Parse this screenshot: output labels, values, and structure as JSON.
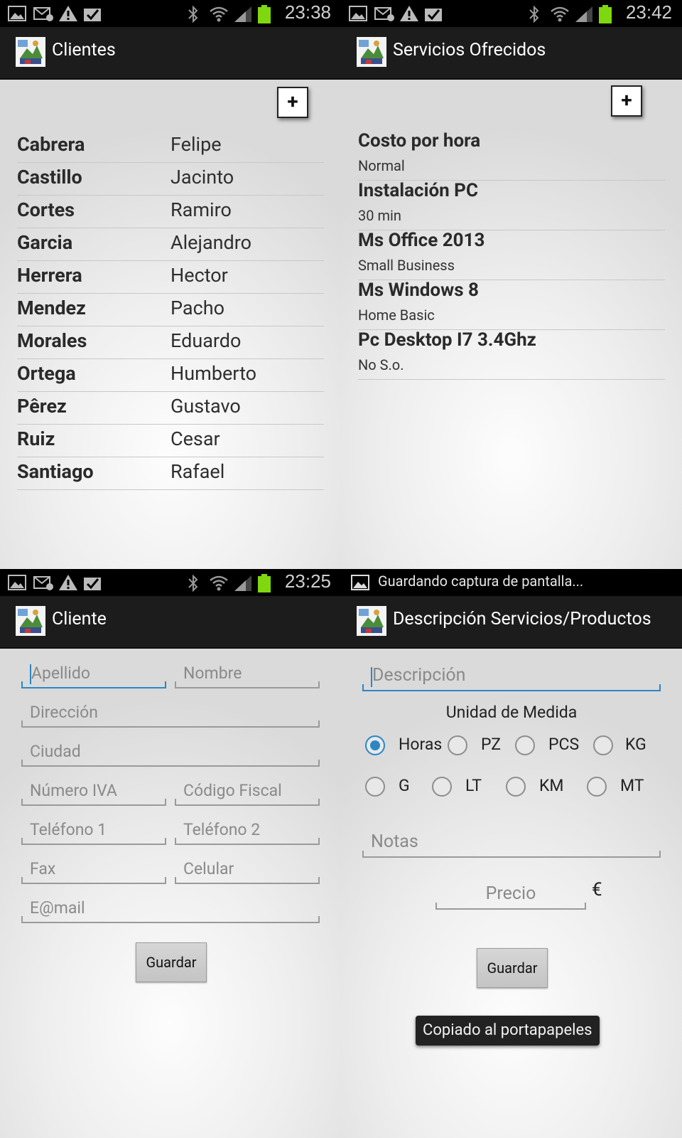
{
  "screen1": {
    "status_time": "23:38",
    "title": "Clientes",
    "add_label": "+",
    "clients": [
      {
        "last": "Cabrera",
        "first": "Felipe"
      },
      {
        "last": "Castillo",
        "first": "Jacinto"
      },
      {
        "last": "Cortes",
        "first": "Ramiro"
      },
      {
        "last": "Garcia",
        "first": "Alejandro"
      },
      {
        "last": "Herrera",
        "first": "Hector"
      },
      {
        "last": "Mendez",
        "first": "Pacho"
      },
      {
        "last": "Morales",
        "first": "Eduardo"
      },
      {
        "last": "Ortega",
        "first": "Humberto"
      },
      {
        "last": "Pêrez",
        "first": "Gustavo"
      },
      {
        "last": "Ruiz",
        "first": "Cesar"
      },
      {
        "last": "Santiago",
        "first": "Rafael"
      }
    ]
  },
  "screen2": {
    "status_time": "23:42",
    "title": "Servicios Ofrecidos",
    "add_label": "+",
    "services": [
      {
        "name": "Costo por hora",
        "desc": "Normal"
      },
      {
        "name": "Instalación PC",
        "desc": "30 min"
      },
      {
        "name": "Ms Office 2013",
        "desc": "Small Business"
      },
      {
        "name": "Ms Windows 8",
        "desc": "Home Basic"
      },
      {
        "name": "Pc Desktop I7 3.4Ghz",
        "desc": "No S.o."
      }
    ]
  },
  "screen3": {
    "status_time": "23:25",
    "title": "Cliente",
    "placeholders": {
      "apellido": "Apellido",
      "nombre": "Nombre",
      "direccion": "Dirección",
      "ciudad": "Ciudad",
      "numero_iva": "Número IVA",
      "codigo_fiscal": "Código Fiscal",
      "telefono1": "Teléfono 1",
      "telefono2": "Teléfono 2",
      "fax": "Fax",
      "celular": "Celular",
      "email": "E@mail"
    },
    "save_label": "Guardar"
  },
  "screen4": {
    "status_note": "Guardando captura de pantalla...",
    "title": "Descripción Servicios/Productos",
    "descripcion_placeholder": "Descripción",
    "unidad_label": "Unidad de Medida",
    "units": [
      "Horas",
      "PZ",
      "PCS",
      "KG",
      "G",
      "LT",
      "KM",
      "MT"
    ],
    "selected_unit": "Horas",
    "notas_placeholder": "Notas",
    "precio_placeholder": "Precio",
    "currency": "€",
    "save_label": "Guardar",
    "toast": "Copiado al portapapeles"
  },
  "colors": {
    "accent": "#2b86c5",
    "actionbar": "#1c1c1c",
    "battery": "#7fd80f"
  }
}
